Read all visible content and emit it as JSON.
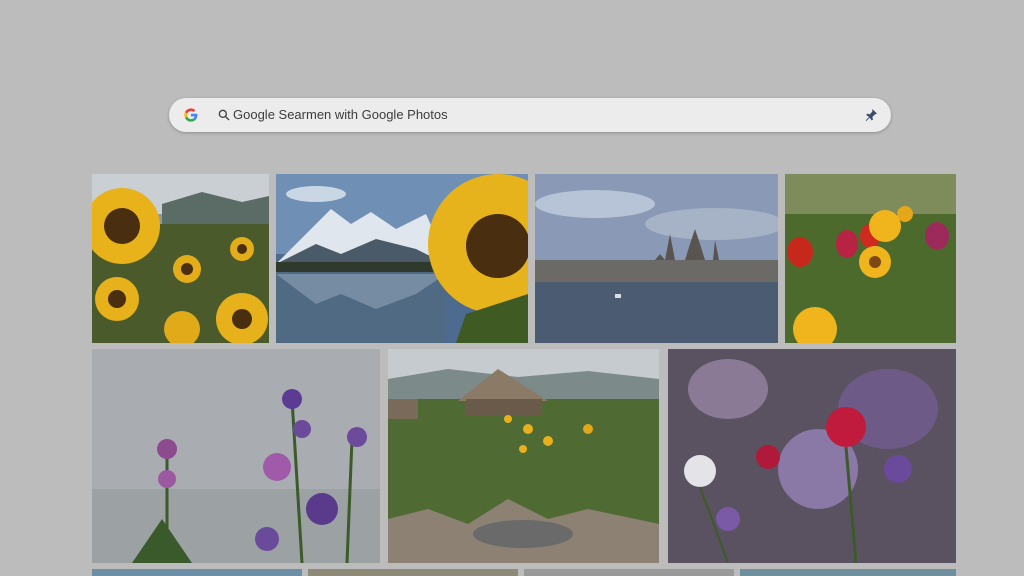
{
  "search": {
    "text": "Google Searmen with Google Photos"
  },
  "icons": {
    "logo": "google-g-icon",
    "search": "search-icon",
    "right": "pin-icon"
  },
  "photos": [
    {
      "name": "sunflowers-field"
    },
    {
      "name": "mountain-lake-sunflower"
    },
    {
      "name": "city-waterfront"
    },
    {
      "name": "tulips-garden"
    },
    {
      "name": "purple-wildflowers"
    },
    {
      "name": "cottage-garden-stream"
    },
    {
      "name": "red-purple-flowers"
    }
  ]
}
